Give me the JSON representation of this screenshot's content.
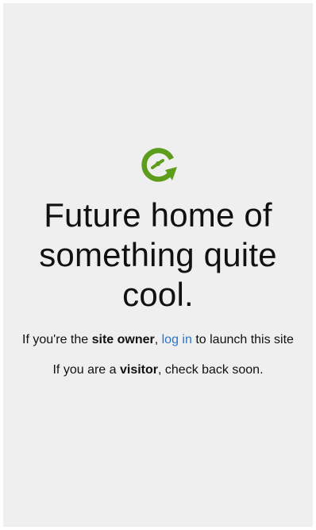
{
  "colors": {
    "background": "#efefef",
    "text": "#111111",
    "link": "#2a73c9",
    "logo_green": "#5e9d1c"
  },
  "logo": {
    "icon": "clock-refresh-icon"
  },
  "headline": {
    "line1": "Future home of",
    "line2": "something quite",
    "line3": "cool."
  },
  "owner_message": {
    "prefix": "If you're the ",
    "bold": "site owner",
    "comma": ", ",
    "link": "log in",
    "suffix": " to launch this site"
  },
  "visitor_message": {
    "prefix": "If you are a ",
    "bold": "visitor",
    "suffix": ", check back soon."
  }
}
